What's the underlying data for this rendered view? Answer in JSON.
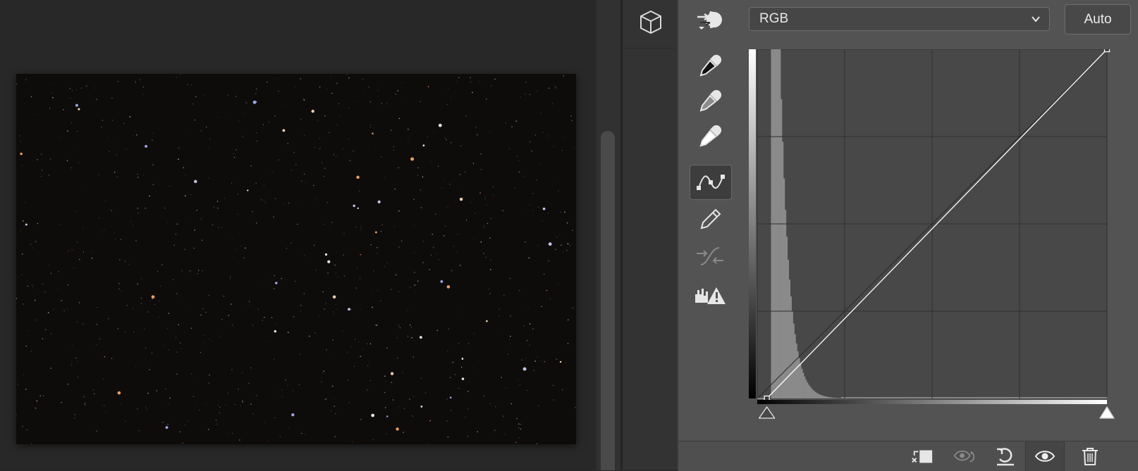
{
  "panel": {
    "channel": "RGB",
    "auto_label": "Auto"
  },
  "icons": {
    "cube": "3d-cube-icon",
    "target_adjust": "targeted-adjustment-icon",
    "eyedropper_black": "black-eyedropper-icon",
    "eyedropper_gray": "gray-eyedropper-icon",
    "eyedropper_white": "white-eyedropper-icon",
    "curve_tool": "curve-edit-icon",
    "pencil_tool": "pencil-icon",
    "smooth": "smooth-curve-icon",
    "clipping": "clipping-warning-icon",
    "clip_to_layer": "clip-to-layer-icon",
    "view_previous": "view-previous-state-icon",
    "reset": "reset-icon",
    "visibility": "eye-icon",
    "delete": "trash-icon"
  },
  "curve": {
    "input_black": 7,
    "input_white": 255,
    "output_black": 0,
    "output_white": 255,
    "histogram_peak_level": 16
  },
  "colors": {
    "panel_bg": "#535353",
    "graph_bg": "#484848",
    "histogram": "#8a8a8a",
    "curve": "#ffffff"
  }
}
